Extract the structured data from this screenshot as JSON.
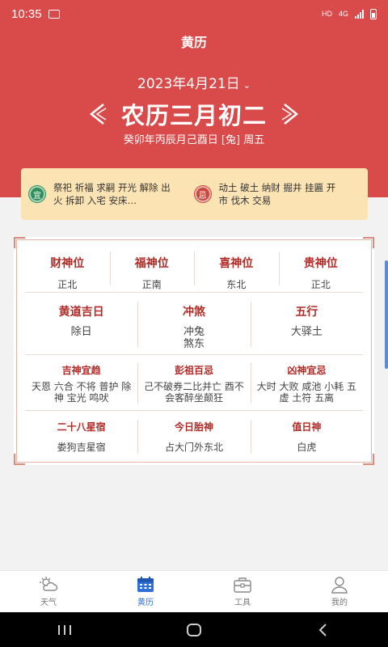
{
  "status_bar": {
    "time": "10:35",
    "hd": "HD",
    "network": "4G"
  },
  "header": {
    "title": "黄历"
  },
  "date": {
    "solar": "2023年4月21日",
    "lunar": "农历三月初二",
    "ganzhi": "癸卯年丙辰月己酉日 [兔] 周五"
  },
  "yiji": {
    "yi_badge": "宜",
    "yi_text": "祭祀 祈福 求嗣 开光 解除 出火 拆卸 入宅 安床…",
    "ji_badge": "忌",
    "ji_text": "动土 破土 纳财 掘井 挂匾 开市 伐木 交易"
  },
  "gods": [
    {
      "label": "财神位",
      "value": "正北"
    },
    {
      "label": "福神位",
      "value": "正南"
    },
    {
      "label": "喜神位",
      "value": "东北"
    },
    {
      "label": "贵神位",
      "value": "正北"
    }
  ],
  "row2": [
    {
      "label": "黄道吉日",
      "value": "除日"
    },
    {
      "label": "冲煞",
      "value": "冲兔\n煞东"
    },
    {
      "label": "五行",
      "value": "大驿土"
    }
  ],
  "row3": [
    {
      "label": "吉神宜趋",
      "value": "天恩 六合 不将 普护 除神 宝光 鸣吠"
    },
    {
      "label": "彭祖百忌",
      "value": "己不破券二比并亡 酉不会客醉坐颠狂"
    },
    {
      "label": "凶神宜忌",
      "value": "大时 大败 咸池 小耗 五虚 土符 五离"
    }
  ],
  "row4": [
    {
      "label": "二十八星宿",
      "value": "娄狗吉星宿"
    },
    {
      "label": "今日胎神",
      "value": "占大门外东北"
    },
    {
      "label": "值日神",
      "value": "白虎"
    }
  ],
  "bottom_nav": [
    {
      "label": "天气",
      "icon": "weather-icon",
      "active": false
    },
    {
      "label": "黄历",
      "icon": "calendar-icon",
      "active": true
    },
    {
      "label": "工具",
      "icon": "toolbox-icon",
      "active": false
    },
    {
      "label": "我的",
      "icon": "user-icon",
      "active": false
    }
  ],
  "colors": {
    "primary_red": "#d94b4b",
    "accent_blue": "#2e6fd8",
    "card_yellow": "#fbe3b4",
    "label_red": "#b22a26"
  }
}
